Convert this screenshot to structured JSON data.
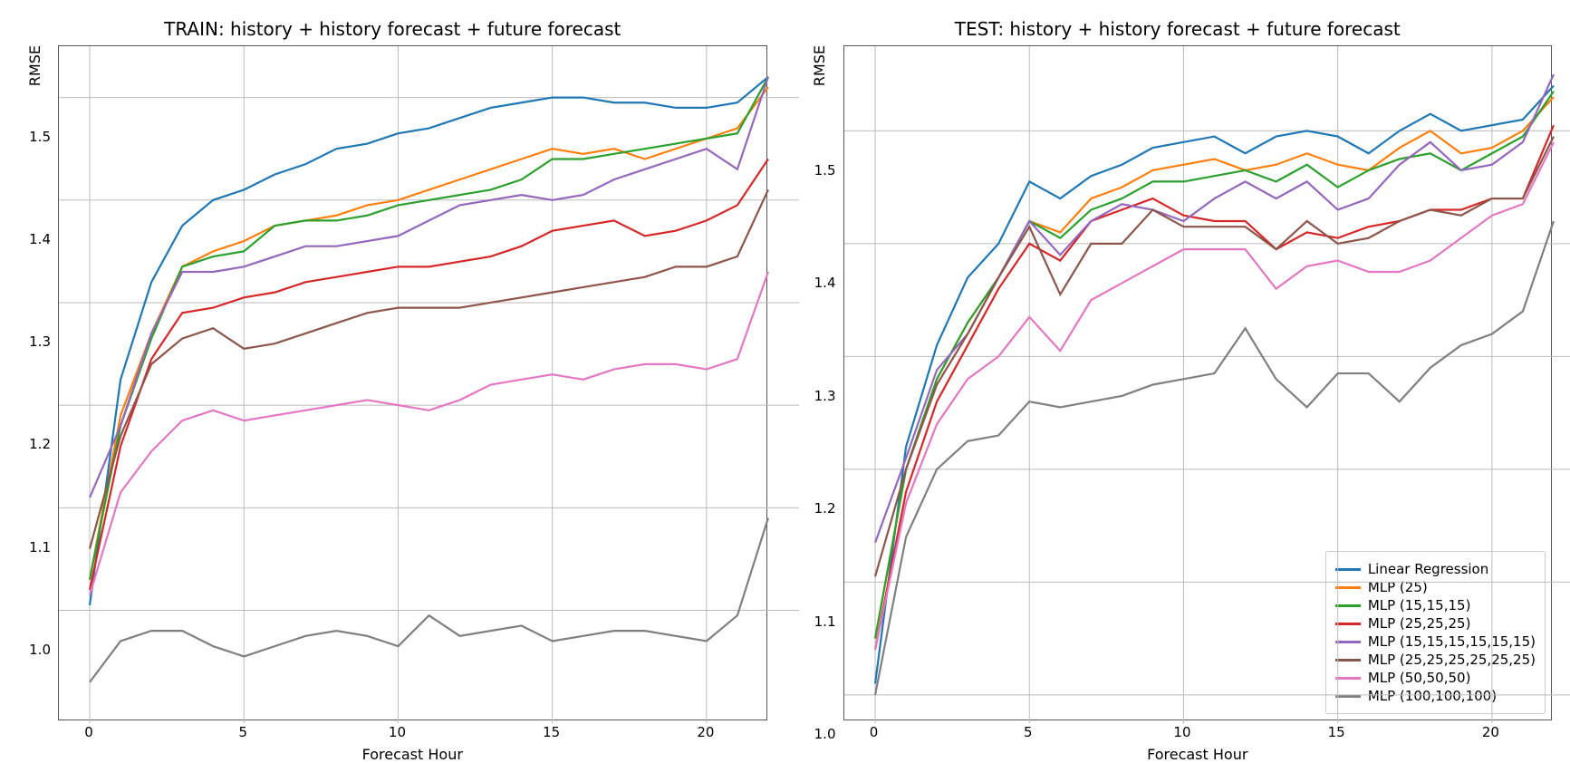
{
  "chart_data": [
    {
      "type": "line",
      "title": "TRAIN: history + history forecast + future forecast",
      "xlabel": "Forecast Hour",
      "ylabel": "RMSE",
      "x": [
        0,
        1,
        2,
        3,
        4,
        5,
        6,
        7,
        8,
        9,
        10,
        11,
        12,
        13,
        14,
        15,
        16,
        17,
        18,
        19,
        20,
        21,
        22
      ],
      "xlim": [
        -1,
        23
      ],
      "ylim": [
        0.89,
        1.55
      ],
      "xticks": [
        0,
        5,
        10,
        15,
        20
      ],
      "yticks": [
        1.0,
        1.1,
        1.2,
        1.3,
        1.4,
        1.5
      ],
      "series": [
        {
          "name": "Linear Regression",
          "color": "#1f77b4",
          "values": [
            1.005,
            1.225,
            1.32,
            1.375,
            1.4,
            1.41,
            1.425,
            1.435,
            1.45,
            1.455,
            1.465,
            1.47,
            1.48,
            1.49,
            1.495,
            1.5,
            1.5,
            1.495,
            1.495,
            1.49,
            1.49,
            1.495,
            1.52
          ]
        },
        {
          "name": "MLP (25)",
          "color": "#ff7f0e",
          "values": [
            1.03,
            1.19,
            1.27,
            1.335,
            1.35,
            1.36,
            1.375,
            1.38,
            1.385,
            1.395,
            1.4,
            1.41,
            1.42,
            1.43,
            1.44,
            1.45,
            1.445,
            1.45,
            1.44,
            1.45,
            1.46,
            1.47,
            1.51
          ]
        },
        {
          "name": "MLP (15,15,15)",
          "color": "#2ca02c",
          "values": [
            1.03,
            1.18,
            1.265,
            1.335,
            1.345,
            1.35,
            1.375,
            1.38,
            1.38,
            1.385,
            1.395,
            1.4,
            1.405,
            1.41,
            1.42,
            1.44,
            1.44,
            1.445,
            1.45,
            1.455,
            1.46,
            1.465,
            1.52
          ]
        },
        {
          "name": "MLP (25,25,25)",
          "color": "#d62728",
          "values": [
            1.02,
            1.16,
            1.245,
            1.29,
            1.295,
            1.305,
            1.31,
            1.32,
            1.325,
            1.33,
            1.335,
            1.335,
            1.34,
            1.345,
            1.355,
            1.37,
            1.375,
            1.38,
            1.365,
            1.37,
            1.38,
            1.395,
            1.44
          ]
        },
        {
          "name": "MLP (15,15,15,15,15,15)",
          "color": "#9467bd",
          "values": [
            1.11,
            1.18,
            1.27,
            1.33,
            1.33,
            1.335,
            1.345,
            1.355,
            1.355,
            1.36,
            1.365,
            1.38,
            1.395,
            1.4,
            1.405,
            1.4,
            1.405,
            1.42,
            1.43,
            1.44,
            1.45,
            1.43,
            1.52
          ]
        },
        {
          "name": "MLP (25,25,25,25,25,25)",
          "color": "#8c564b",
          "values": [
            1.06,
            1.17,
            1.24,
            1.265,
            1.275,
            1.255,
            1.26,
            1.27,
            1.28,
            1.29,
            1.295,
            1.295,
            1.295,
            1.3,
            1.305,
            1.31,
            1.315,
            1.32,
            1.325,
            1.335,
            1.335,
            1.345,
            1.41
          ]
        },
        {
          "name": "MLP (50,50,50)",
          "color": "#e377c2",
          "values": [
            1.015,
            1.115,
            1.155,
            1.185,
            1.195,
            1.185,
            1.19,
            1.195,
            1.2,
            1.205,
            1.2,
            1.195,
            1.205,
            1.22,
            1.225,
            1.23,
            1.225,
            1.235,
            1.24,
            1.24,
            1.235,
            1.245,
            1.33
          ]
        },
        {
          "name": "MLP (100,100,100)",
          "color": "#7f7f7f",
          "values": [
            0.93,
            0.97,
            0.98,
            0.98,
            0.965,
            0.955,
            0.965,
            0.975,
            0.98,
            0.975,
            0.965,
            0.995,
            0.975,
            0.98,
            0.985,
            0.97,
            0.975,
            0.98,
            0.98,
            0.975,
            0.97,
            0.995,
            1.09
          ]
        }
      ]
    },
    {
      "type": "line",
      "title": "TEST: history + history forecast + future forecast",
      "xlabel": "Forecast Hour",
      "ylabel": "RMSE",
      "x": [
        0,
        1,
        2,
        3,
        4,
        5,
        6,
        7,
        8,
        9,
        10,
        11,
        12,
        13,
        14,
        15,
        16,
        17,
        18,
        19,
        20,
        21,
        22
      ],
      "xlim": [
        -1,
        23
      ],
      "ylim": [
        0.975,
        1.575
      ],
      "xticks": [
        0,
        5,
        10,
        15,
        20
      ],
      "yticks": [
        1.0,
        1.1,
        1.2,
        1.3,
        1.4,
        1.5
      ],
      "legend_position": "lower right",
      "series": [
        {
          "name": "Linear Regression",
          "color": "#1f77b4",
          "values": [
            1.01,
            1.22,
            1.31,
            1.37,
            1.4,
            1.455,
            1.44,
            1.46,
            1.47,
            1.485,
            1.49,
            1.495,
            1.48,
            1.495,
            1.5,
            1.495,
            1.48,
            1.5,
            1.515,
            1.5,
            1.505,
            1.51,
            1.54
          ]
        },
        {
          "name": "MLP (25)",
          "color": "#ff7f0e",
          "values": [
            1.05,
            1.2,
            1.28,
            1.33,
            1.37,
            1.42,
            1.41,
            1.44,
            1.45,
            1.465,
            1.47,
            1.475,
            1.465,
            1.47,
            1.48,
            1.47,
            1.465,
            1.485,
            1.5,
            1.48,
            1.485,
            1.5,
            1.53
          ]
        },
        {
          "name": "MLP (15,15,15)",
          "color": "#2ca02c",
          "values": [
            1.05,
            1.2,
            1.28,
            1.33,
            1.37,
            1.42,
            1.405,
            1.43,
            1.44,
            1.455,
            1.455,
            1.46,
            1.465,
            1.455,
            1.47,
            1.45,
            1.465,
            1.475,
            1.48,
            1.465,
            1.48,
            1.495,
            1.535
          ]
        },
        {
          "name": "MLP (25,25,25)",
          "color": "#d62728",
          "values": [
            1.04,
            1.18,
            1.26,
            1.31,
            1.36,
            1.4,
            1.385,
            1.42,
            1.43,
            1.44,
            1.425,
            1.42,
            1.42,
            1.395,
            1.41,
            1.405,
            1.415,
            1.42,
            1.43,
            1.43,
            1.44,
            1.44,
            1.505
          ]
        },
        {
          "name": "MLP (15,15,15,15,15,15)",
          "color": "#9467bd",
          "values": [
            1.135,
            1.21,
            1.288,
            1.32,
            1.37,
            1.42,
            1.39,
            1.42,
            1.435,
            1.43,
            1.42,
            1.44,
            1.455,
            1.44,
            1.455,
            1.43,
            1.44,
            1.47,
            1.49,
            1.465,
            1.47,
            1.49,
            1.55
          ]
        },
        {
          "name": "MLP (25,25,25,25,25,25)",
          "color": "#8c564b",
          "values": [
            1.105,
            1.2,
            1.275,
            1.32,
            1.37,
            1.415,
            1.355,
            1.4,
            1.4,
            1.43,
            1.415,
            1.415,
            1.415,
            1.395,
            1.42,
            1.4,
            1.405,
            1.42,
            1.43,
            1.425,
            1.44,
            1.44,
            1.495
          ]
        },
        {
          "name": "MLP (50,50,50)",
          "color": "#e377c2",
          "values": [
            1.04,
            1.17,
            1.24,
            1.28,
            1.3,
            1.335,
            1.305,
            1.35,
            1.365,
            1.38,
            1.395,
            1.395,
            1.395,
            1.36,
            1.38,
            1.385,
            1.375,
            1.375,
            1.385,
            1.405,
            1.425,
            1.435,
            1.49
          ]
        },
        {
          "name": "MLP (100,100,100)",
          "color": "#7f7f7f",
          "values": [
            1.0,
            1.14,
            1.2,
            1.225,
            1.23,
            1.26,
            1.255,
            1.26,
            1.265,
            1.275,
            1.28,
            1.285,
            1.325,
            1.28,
            1.255,
            1.285,
            1.285,
            1.26,
            1.29,
            1.31,
            1.32,
            1.34,
            1.42
          ]
        }
      ]
    }
  ]
}
